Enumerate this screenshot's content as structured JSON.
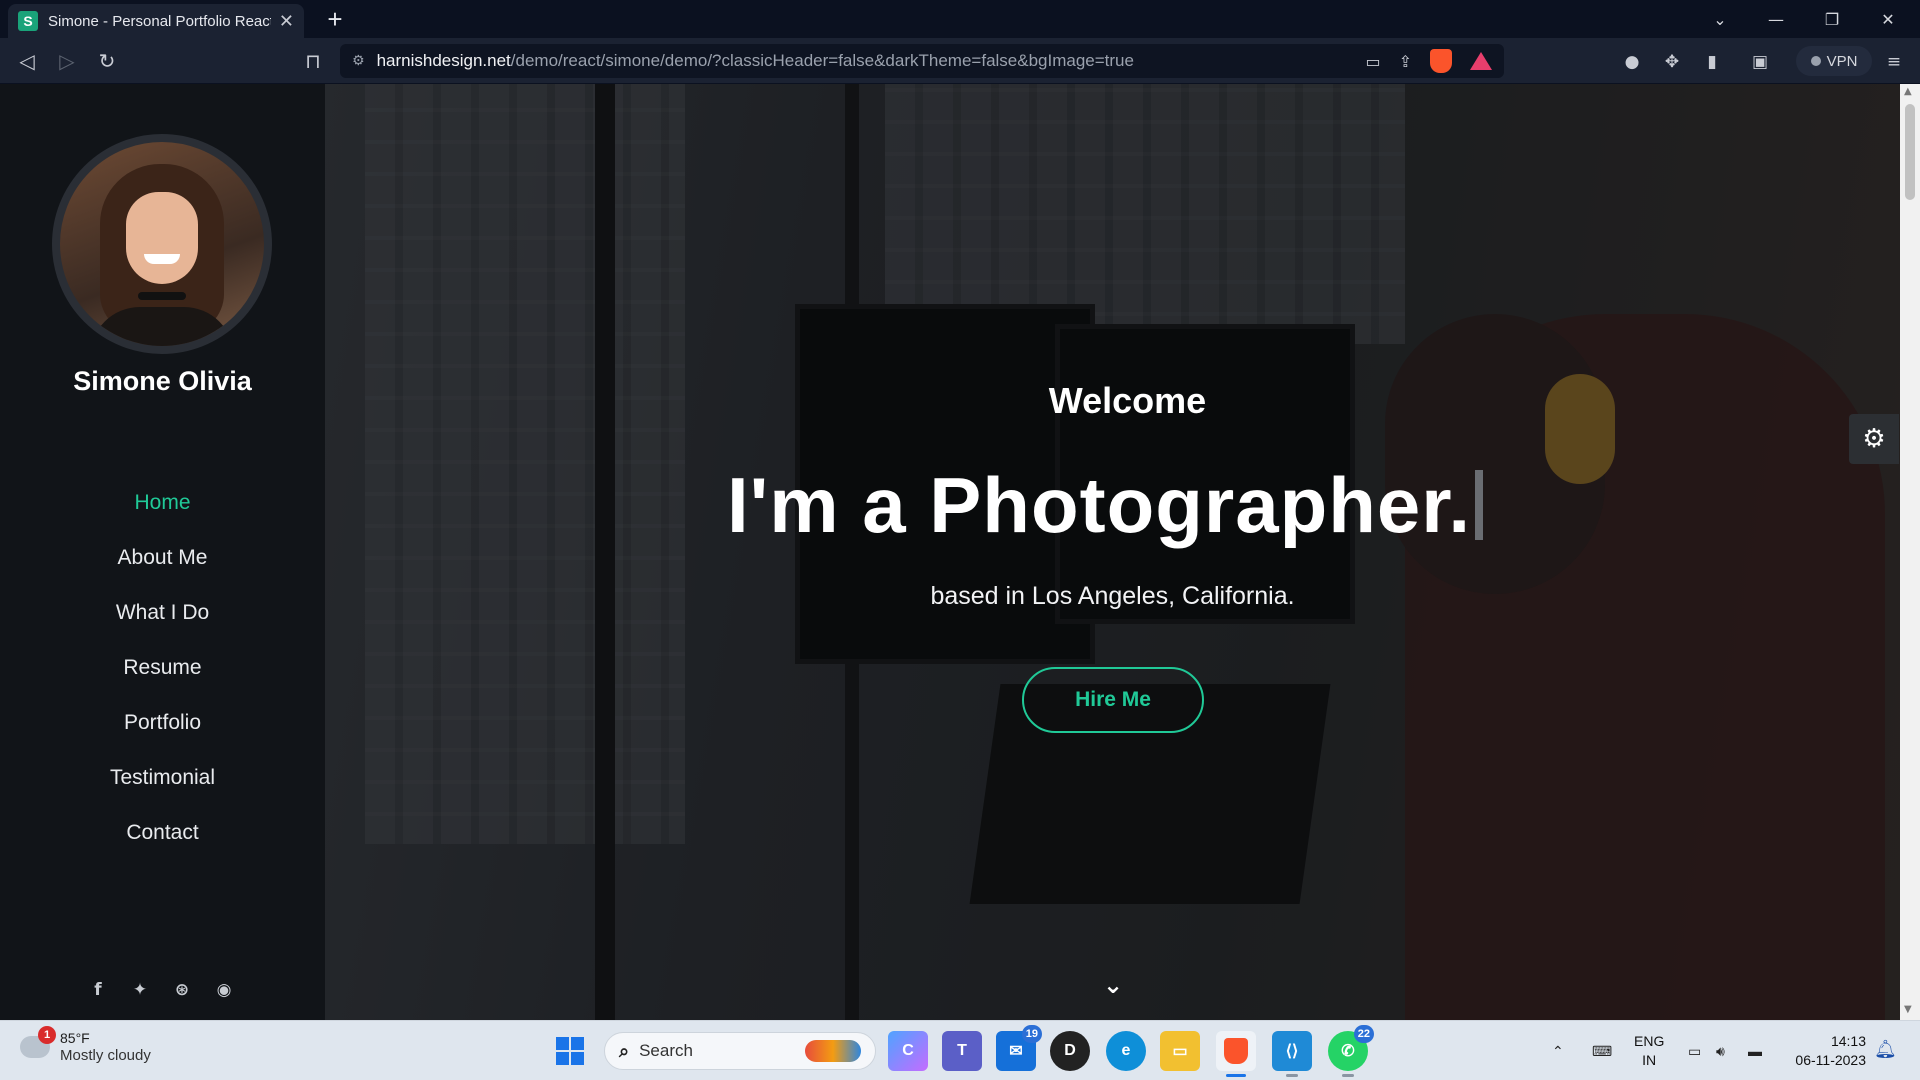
{
  "browser": {
    "tab_title": "Simone - Personal Portfolio React",
    "tab_favicon": "S",
    "url_host": "harnishdesign.net",
    "url_path": "/demo/react/simone/demo/?classicHeader=false&darkTheme=false&bgImage=true",
    "vpn_label": "VPN"
  },
  "sidebar": {
    "name": "Simone Olivia",
    "menu": [
      {
        "label": "Home",
        "active": true
      },
      {
        "label": "About Me",
        "active": false
      },
      {
        "label": "What I Do",
        "active": false
      },
      {
        "label": "Resume",
        "active": false
      },
      {
        "label": "Portfolio",
        "active": false
      },
      {
        "label": "Testimonial",
        "active": false
      },
      {
        "label": "Contact",
        "active": false
      }
    ],
    "social": [
      "facebook-icon",
      "twitter-icon",
      "dribbble-icon",
      "github-icon"
    ]
  },
  "hero": {
    "welcome": "Welcome",
    "headline": "I'm a Photographer.",
    "subline": "based in Los Angeles, California.",
    "cta": "Hire Me"
  },
  "colors": {
    "accent": "#20c997",
    "sidebar_bg": "#111418"
  },
  "taskbar": {
    "weather_temp": "85°F",
    "weather_desc": "Mostly cloudy",
    "weather_badge": "1",
    "search_label": "Search",
    "mail_badge": "19",
    "whatsapp_badge": "22",
    "lang_top": "ENG",
    "lang_bottom": "IN",
    "time": "14:13",
    "date": "06-11-2023"
  }
}
